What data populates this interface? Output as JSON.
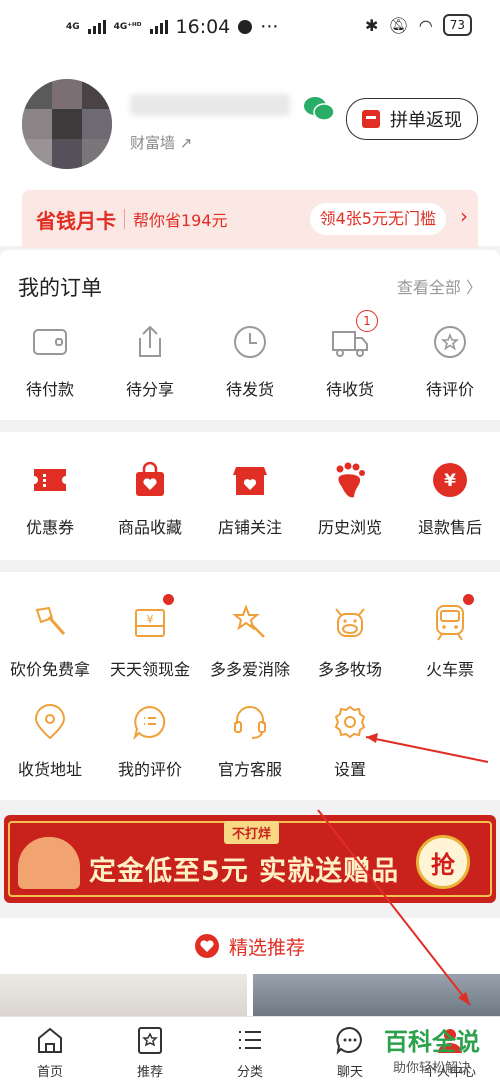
{
  "status_bar": {
    "net1": "4G",
    "net2": "4G⁺ᴴᴰ",
    "time": "16:04",
    "more": "···",
    "battery": "73"
  },
  "profile": {
    "sub_text": "财富墙 ↗",
    "pindan_label": "拼单返现"
  },
  "money_card": {
    "title": "省钱月卡",
    "subtitle": "帮你省194元",
    "button": "领4张5元无门槛",
    "chevron": "›"
  },
  "orders": {
    "title": "我的订单",
    "view_all": "查看全部 〉",
    "items": [
      {
        "label": "待付款",
        "icon": "wallet-icon"
      },
      {
        "label": "待分享",
        "icon": "share-icon"
      },
      {
        "label": "待发货",
        "icon": "clock-icon"
      },
      {
        "label": "待收货",
        "icon": "truck-icon",
        "badge": "1"
      },
      {
        "label": "待评价",
        "icon": "review-icon"
      }
    ]
  },
  "services": {
    "items": [
      {
        "label": "优惠券",
        "icon": "coupon-icon"
      },
      {
        "label": "商品收藏",
        "icon": "favorite-bag-icon"
      },
      {
        "label": "店铺关注",
        "icon": "shop-icon"
      },
      {
        "label": "历史浏览",
        "icon": "footprint-icon"
      },
      {
        "label": "退款售后",
        "icon": "refund-icon"
      }
    ]
  },
  "tools": {
    "row1": [
      {
        "label": "砍价免费拿",
        "icon": "axe-icon"
      },
      {
        "label": "天天领现金",
        "icon": "cash-icon",
        "dot": true
      },
      {
        "label": "多多爱消除",
        "icon": "wand-icon"
      },
      {
        "label": "多多牧场",
        "icon": "cow-icon"
      },
      {
        "label": "火车票",
        "icon": "train-icon",
        "dot": true
      }
    ],
    "row2": [
      {
        "label": "收货地址",
        "icon": "location-icon"
      },
      {
        "label": "我的评价",
        "icon": "comment-icon"
      },
      {
        "label": "官方客服",
        "icon": "headset-icon"
      },
      {
        "label": "设置",
        "icon": "settings-icon"
      }
    ]
  },
  "banner": {
    "tag": "不打烊",
    "text": "定金低至5元 实就送赠品",
    "grab": "抢"
  },
  "recommend": {
    "title": "精选推荐"
  },
  "tabbar": [
    {
      "label": "首页",
      "icon": "home-icon"
    },
    {
      "label": "推荐",
      "icon": "star-bag-icon"
    },
    {
      "label": "分类",
      "icon": "list-icon"
    },
    {
      "label": "聊天",
      "icon": "chat-icon"
    },
    {
      "label": "个人中心",
      "icon": "person-icon"
    }
  ],
  "watermark": {
    "title": "百科全说",
    "subtitle": "助你轻松解决"
  },
  "colors": {
    "accent": "#e02e24",
    "tool_orange": "#f0a03a",
    "order_grey": "#999999"
  }
}
